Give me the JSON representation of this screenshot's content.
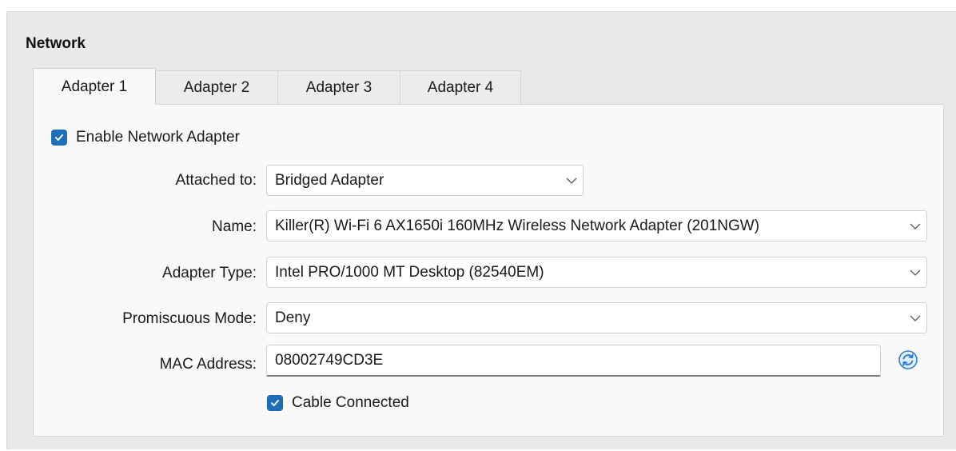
{
  "section": {
    "title": "Network"
  },
  "tabs": [
    {
      "label": "Adapter 1",
      "active": true
    },
    {
      "label": "Adapter 2",
      "active": false
    },
    {
      "label": "Adapter 3",
      "active": false
    },
    {
      "label": "Adapter 4",
      "active": false
    }
  ],
  "enable_adapter": {
    "label": "Enable Network Adapter",
    "checked": true
  },
  "attached_to": {
    "label": "Attached to:",
    "value": "Bridged Adapter"
  },
  "name": {
    "label": "Name:",
    "value": "Killer(R) Wi-Fi 6 AX1650i 160MHz Wireless Network Adapter (201NGW)"
  },
  "adapter_type": {
    "label": "Adapter Type:",
    "value": "Intel PRO/1000 MT Desktop (82540EM)"
  },
  "promiscuous_mode": {
    "label": "Promiscuous Mode:",
    "value": "Deny"
  },
  "mac_address": {
    "label": "MAC Address:",
    "value": "08002749CD3E"
  },
  "cable_connected": {
    "label": "Cable Connected",
    "checked": true
  },
  "icons": {
    "checkbox": "checkmark-icon",
    "dropdown": "chevron-down-icon",
    "refresh": "refresh-mac-icon"
  },
  "colors": {
    "accent": "#1c6fb8",
    "refresh_icon": "#2b7fd6",
    "panel_bg": "#e9e9e9",
    "content_bg": "#f9f9f9"
  }
}
